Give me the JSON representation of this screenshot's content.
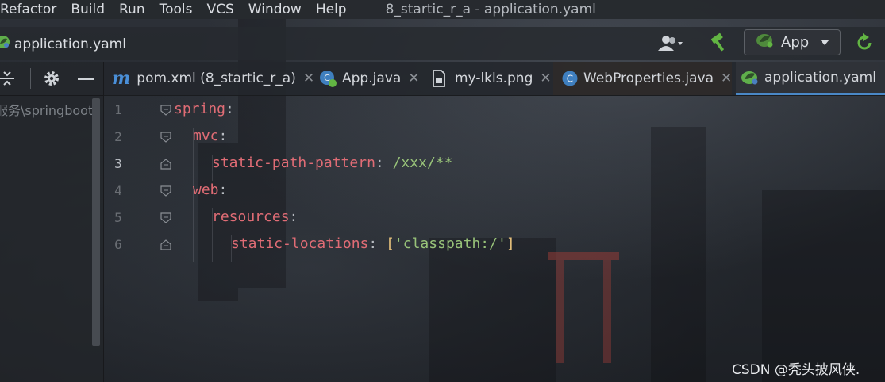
{
  "menubar": {
    "items": [
      "Refactor",
      "Build",
      "Run",
      "Tools",
      "VCS",
      "Window",
      "Help"
    ],
    "window_title": "8_startic_r_a - application.yaml"
  },
  "navbar": {
    "breadcrumb_file": "application.yaml",
    "run_config": "App"
  },
  "project_panel": {
    "path_text": "服务\\springboot\\"
  },
  "tabs": [
    {
      "label": "pom.xml (8_startic_r_a)",
      "icon": "maven-icon",
      "active": false
    },
    {
      "label": "App.java",
      "icon": "spring-boot-class-icon",
      "active": false
    },
    {
      "label": "my-lkls.png",
      "icon": "image-file-icon",
      "active": false
    },
    {
      "label": "WebProperties.java",
      "icon": "java-class-icon",
      "active": false
    },
    {
      "label": "application.yaml",
      "icon": "spring-leaf-icon",
      "active": true
    }
  ],
  "editor": {
    "current_line": 3,
    "lines": [
      {
        "num": "1",
        "key": "spring",
        "colon": ":",
        "value": ""
      },
      {
        "num": "2",
        "key": "mvc",
        "colon": ":",
        "value": ""
      },
      {
        "num": "3",
        "key": "static-path-pattern",
        "colon": ": ",
        "value": "/xxx/**"
      },
      {
        "num": "4",
        "key": "web",
        "colon": ":",
        "value": ""
      },
      {
        "num": "5",
        "key": "resources",
        "colon": ":",
        "value": ""
      },
      {
        "num": "6",
        "key": "static-locations",
        "colon": ": ",
        "value": "'classpath:/'",
        "open_bracket": "[",
        "close_bracket": "]"
      }
    ]
  },
  "watermark": "CSDN @秃头披风侠.",
  "colors": {
    "key": "#e06c75",
    "string": "#98c379",
    "bracket": "#e5c07b",
    "accent": "#4a88c7"
  }
}
